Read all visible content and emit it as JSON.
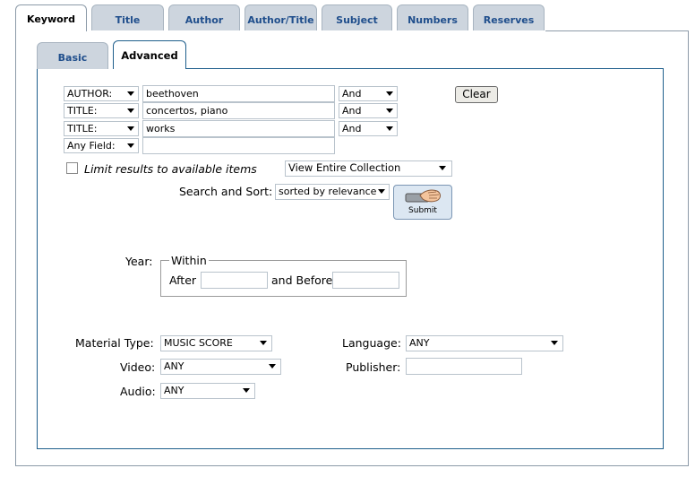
{
  "tabs": [
    {
      "label": "Keyword",
      "active": true
    },
    {
      "label": "Title"
    },
    {
      "label": "Author"
    },
    {
      "label": "Author/Title"
    },
    {
      "label": "Subject"
    },
    {
      "label": "Numbers"
    },
    {
      "label": "Reserves"
    }
  ],
  "subtabs": [
    {
      "label": "Basic"
    },
    {
      "label": "Advanced",
      "active": true
    }
  ],
  "search_rows": [
    {
      "field": "AUTHOR:",
      "term": "beethoven",
      "operator": "And"
    },
    {
      "field": "TITLE:",
      "term": "concertos, piano",
      "operator": "And"
    },
    {
      "field": "TITLE:",
      "term": "works",
      "operator": "And"
    },
    {
      "field": "Any Field:",
      "term": ""
    }
  ],
  "clear_label": "Clear",
  "limit": {
    "label": "Limit results to available items",
    "checked": false
  },
  "collection": "View Entire Collection",
  "sort": {
    "label": "Search and Sort:",
    "value": "sorted by relevance"
  },
  "submit_label": "Submit",
  "year": {
    "label": "Year:",
    "legend": "Within",
    "after_label": "After",
    "after_value": "",
    "before_label": "and Before",
    "before_value": ""
  },
  "filters": {
    "material_type": {
      "label": "Material Type:",
      "value": "MUSIC SCORE"
    },
    "language": {
      "label": "Language:",
      "value": "ANY"
    },
    "video": {
      "label": "Video:",
      "value": "ANY"
    },
    "publisher": {
      "label": "Publisher:",
      "value": ""
    },
    "audio": {
      "label": "Audio:",
      "value": "ANY"
    }
  }
}
